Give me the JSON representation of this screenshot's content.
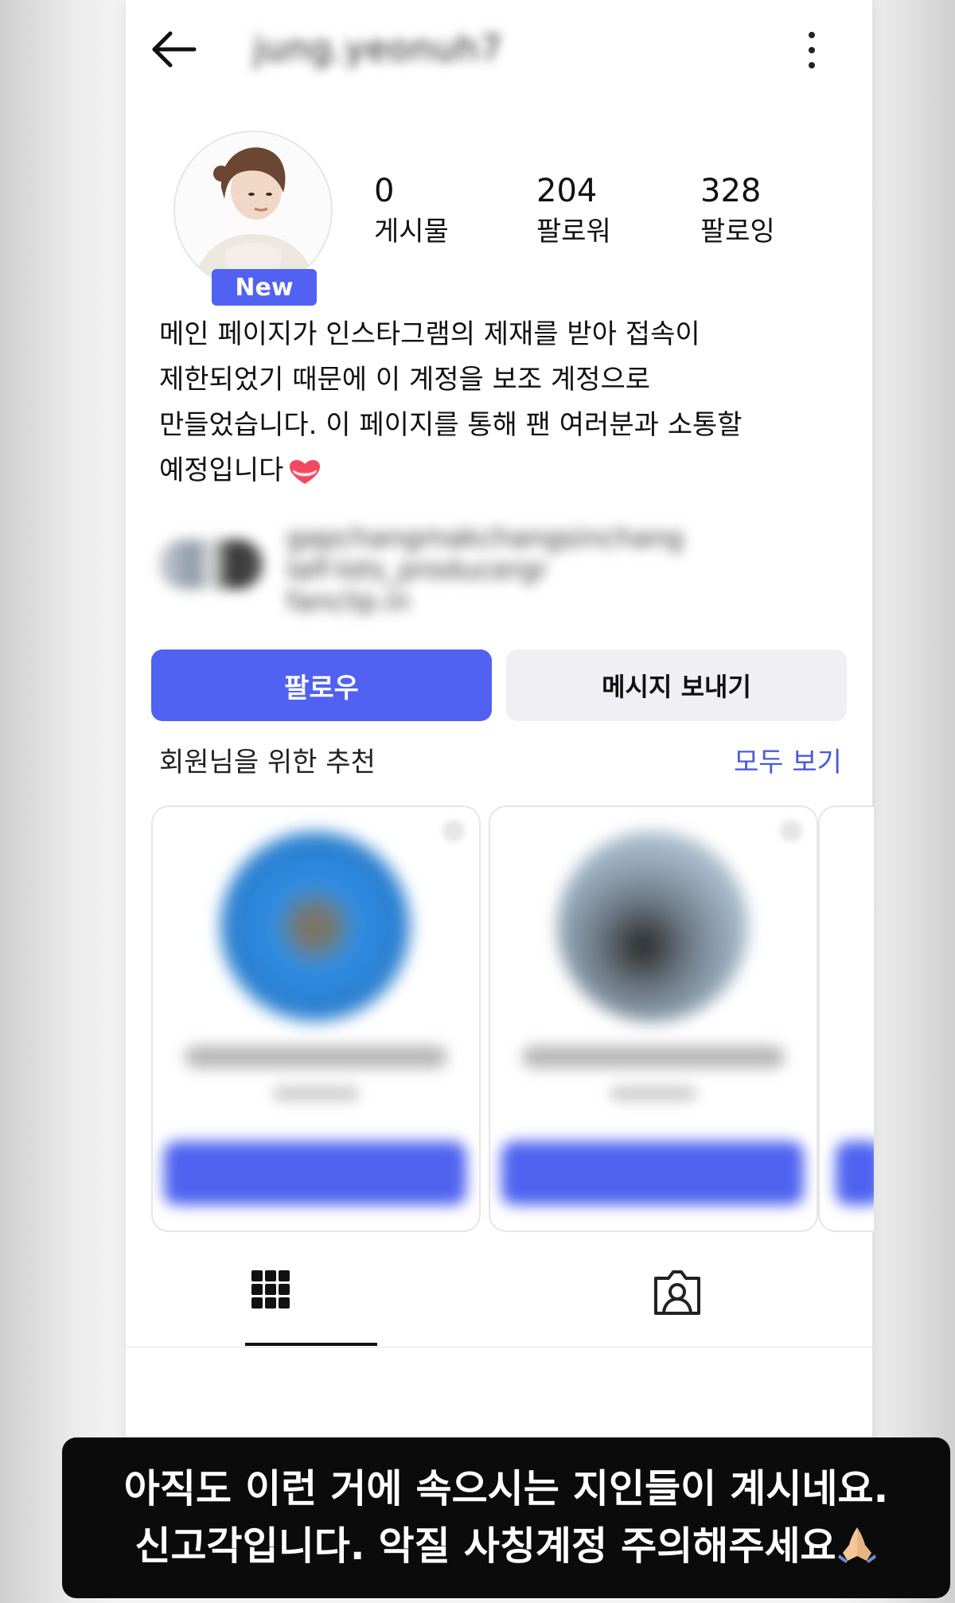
{
  "header": {
    "username": "jung.yeonuh7",
    "back_icon": "arrow-left-icon",
    "menu_icon": "more-vertical-icon"
  },
  "profile": {
    "new_badge": "New",
    "stats": [
      {
        "value": "0",
        "label": "게시물"
      },
      {
        "value": "204",
        "label": "팔로워"
      },
      {
        "value": "328",
        "label": "팔로잉"
      }
    ],
    "bio": "메인 페이지가 인스타그램의 제재를 받아 접속이\n제한되었기 때문에 이 계정을 보조 계정으로\n만들었습니다. 이 페이지를 통해 팬 여러분과 소통할\n예정입니다",
    "bio_emoji": "heart-icon",
    "linked_text": "gapchangmakchangsinchang\nIalf-lots_producergr\nfanclip.in"
  },
  "actions": {
    "follow": "팔로우",
    "message": "메시지 보내기"
  },
  "suggestions": {
    "title": "회원님을 위한 추천",
    "see_all": "모두 보기"
  },
  "tabs": [
    "grid-icon",
    "tagged-icon"
  ],
  "caption": {
    "line1": "아직도 이런 거에 속으시는 지인들이 계시네요.",
    "line2": "신고각입니다. 악질 사칭계정 주의해주세요",
    "emoji": "folded-hands-icon"
  },
  "colors": {
    "accent": "#5162f2",
    "link": "#4a5bd8",
    "secondary_button": "#efeff4",
    "caption_bg": "#0b0b0b"
  }
}
